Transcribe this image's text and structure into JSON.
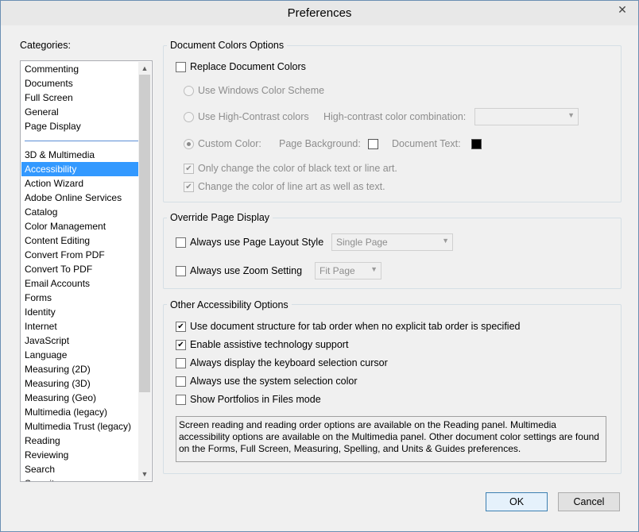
{
  "window": {
    "title": "Preferences",
    "close_glyph": "✕"
  },
  "categories": {
    "label": "Categories:",
    "group1": [
      "Commenting",
      "Documents",
      "Full Screen",
      "General",
      "Page Display"
    ],
    "group2": [
      "3D & Multimedia",
      "Accessibility",
      "Action Wizard",
      "Adobe Online Services",
      "Catalog",
      "Color Management",
      "Content Editing",
      "Convert From PDF",
      "Convert To PDF",
      "Email Accounts",
      "Forms",
      "Identity",
      "Internet",
      "JavaScript",
      "Language",
      "Measuring (2D)",
      "Measuring (3D)",
      "Measuring (Geo)",
      "Multimedia (legacy)",
      "Multimedia Trust (legacy)",
      "Reading",
      "Reviewing",
      "Search",
      "Security"
    ],
    "selected": "Accessibility"
  },
  "doc_colors": {
    "legend": "Document Colors Options",
    "replace_label": "Replace Document Colors",
    "replace_checked": false,
    "windows_scheme_label": "Use Windows Color Scheme",
    "high_contrast_label": "Use High-Contrast colors",
    "combination_label": "High-contrast color combination:",
    "combination_value": "",
    "custom_color_label": "Custom Color:",
    "page_background_label": "Page Background:",
    "page_background_color": "#ffffff",
    "document_text_label": "Document Text:",
    "document_text_color": "#000000",
    "only_black_label": "Only change the color of black text or line art.",
    "line_art_label": "Change the color of line art as well as text."
  },
  "override": {
    "legend": "Override Page Display",
    "layout_label": "Always use Page Layout Style",
    "layout_value": "Single Page",
    "zoom_label": "Always use Zoom Setting",
    "zoom_value": "Fit Page"
  },
  "other": {
    "legend": "Other Accessibility Options",
    "tab_order_label": "Use document structure for tab order when no explicit tab order is specified",
    "assistive_label": "Enable assistive technology support",
    "cursor_label": "Always display the keyboard selection cursor",
    "system_color_label": "Always use the system selection color",
    "portfolios_label": "Show Portfolios in Files mode",
    "info_text": "Screen reading and reading order options are available on the Reading panel. Multimedia accessibility options are available on the Multimedia panel. Other document color settings are found on the Forms, Full Screen, Measuring, Spelling, and Units & Guides preferences."
  },
  "buttons": {
    "ok": "OK",
    "cancel": "Cancel"
  }
}
